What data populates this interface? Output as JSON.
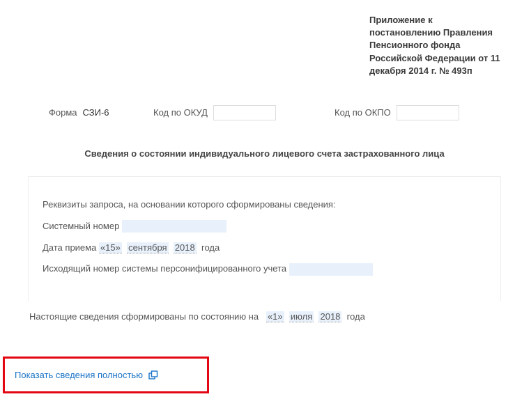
{
  "header": {
    "attachment": "Приложение к постановлению Правления Пенсионного фонда Российской Федерации от 11 декабря 2014 г. № 493п"
  },
  "form": {
    "name_label": "Форма",
    "name_value": "СЗИ-6",
    "okud_label": "Код по ОКУД",
    "okud_value": "",
    "okpo_label": "Код по ОКПО",
    "okpo_value": ""
  },
  "title": "Сведения о состоянии индивидуального лицевого счета застрахованного лица",
  "details": {
    "request_line": "Реквизиты запроса, на основании которого сформированы сведения:",
    "sys_number_label": "Системный номер",
    "sys_number_value": "",
    "date_prefix": "Дата приема",
    "date_day": "«15»",
    "date_month": "сентября",
    "date_year": "2018",
    "date_suffix": "года",
    "outgoing_label": "Исходящий номер системы персонифицированного учета",
    "outgoing_value": ""
  },
  "status": {
    "prefix": "Настоящие сведения сформированы по состоянию на",
    "day": "«1»",
    "month": "июля",
    "year": "2018",
    "suffix": "года"
  },
  "action": {
    "show_full": "Показать сведения полностью"
  }
}
